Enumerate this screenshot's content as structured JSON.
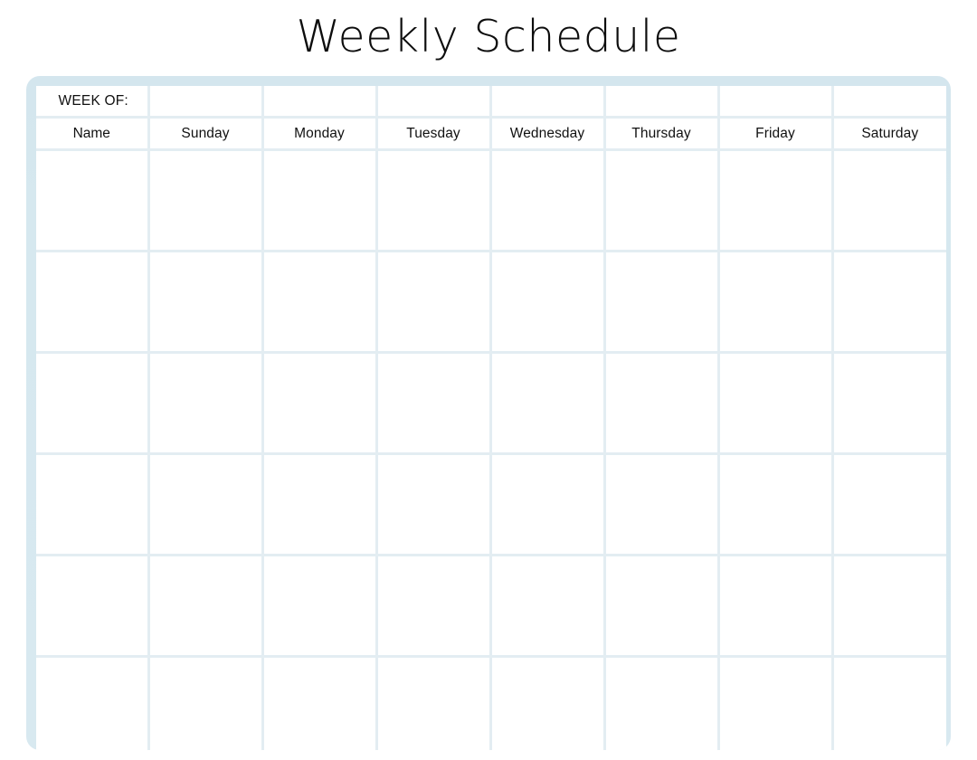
{
  "page": {
    "title": "Weekly Schedule",
    "background_color": "#ffffff"
  },
  "theme": {
    "frame_color": "#d6e8ef",
    "gridline_color": "#e3edf2",
    "cell_color": "#ffffff",
    "text_color": "#111111",
    "title_color": "#0d0d0d"
  },
  "table": {
    "week_of_label": "WEEK OF:",
    "name_column_header": "Name",
    "day_headers": [
      "Sunday",
      "Monday",
      "Tuesday",
      "Wednesday",
      "Thursday",
      "Friday",
      "Saturday"
    ],
    "week_of_values": [
      "",
      "",
      "",
      "",
      "",
      "",
      ""
    ],
    "column_count": 8,
    "body_row_count": 6,
    "body_rows": [
      {
        "name": "",
        "days": [
          "",
          "",
          "",
          "",
          "",
          "",
          ""
        ]
      },
      {
        "name": "",
        "days": [
          "",
          "",
          "",
          "",
          "",
          "",
          ""
        ]
      },
      {
        "name": "",
        "days": [
          "",
          "",
          "",
          "",
          "",
          "",
          ""
        ]
      },
      {
        "name": "",
        "days": [
          "",
          "",
          "",
          "",
          "",
          "",
          ""
        ]
      },
      {
        "name": "",
        "days": [
          "",
          "",
          "",
          "",
          "",
          "",
          ""
        ]
      },
      {
        "name": "",
        "days": [
          "",
          "",
          "",
          "",
          "",
          "",
          ""
        ]
      }
    ]
  }
}
